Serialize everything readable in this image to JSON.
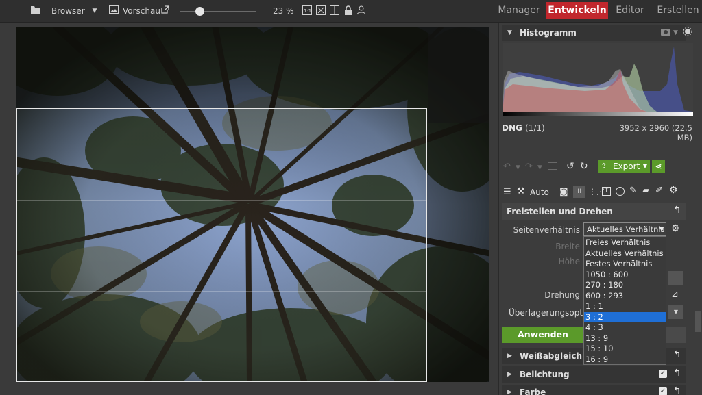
{
  "toolbar": {
    "browser_label": "Browser",
    "preview_label": "Vorschau",
    "zoom_slider_fraction": 0.26,
    "zoom_label": "23 %"
  },
  "nav": {
    "tabs": [
      "Manager",
      "Entwickeln",
      "Editor",
      "Erstellen"
    ],
    "active": "Entwickeln"
  },
  "histogram": {
    "title": "Histogramm",
    "format": "DNG",
    "count": "(1/1)",
    "dimensions": "3952 x 2960 (22.5 MB)"
  },
  "actions": {
    "export_label": "Export",
    "auto_label": "Auto"
  },
  "crop": {
    "title": "Freistellen und Drehen",
    "aspect_label": "Seitenverhältnis",
    "aspect_value": "Aktuelles Verhältnis",
    "width_label": "Breite",
    "height_label": "Höhe",
    "rotation_label": "Drehung",
    "overlay_label": "Überlagerungsopti...",
    "apply_label": "Anwenden",
    "options": [
      "Freies Verhältnis",
      "Aktuelles Verhältnis",
      "Festes Verhältnis",
      "1050 : 600",
      "270 : 180",
      "600 : 293",
      "1 : 1",
      "3 : 2",
      "4 : 3",
      "13 : 9",
      "15 : 10",
      "16 : 9"
    ],
    "selected_option": "3 : 2"
  },
  "sections": {
    "white_balance": "Weißabgleich",
    "exposure": "Belichtung",
    "color": "Farbe"
  },
  "colors": {
    "accent_red": "#c1272d",
    "accent_green": "#5b9a2a",
    "selection_blue": "#1f6fd6"
  }
}
